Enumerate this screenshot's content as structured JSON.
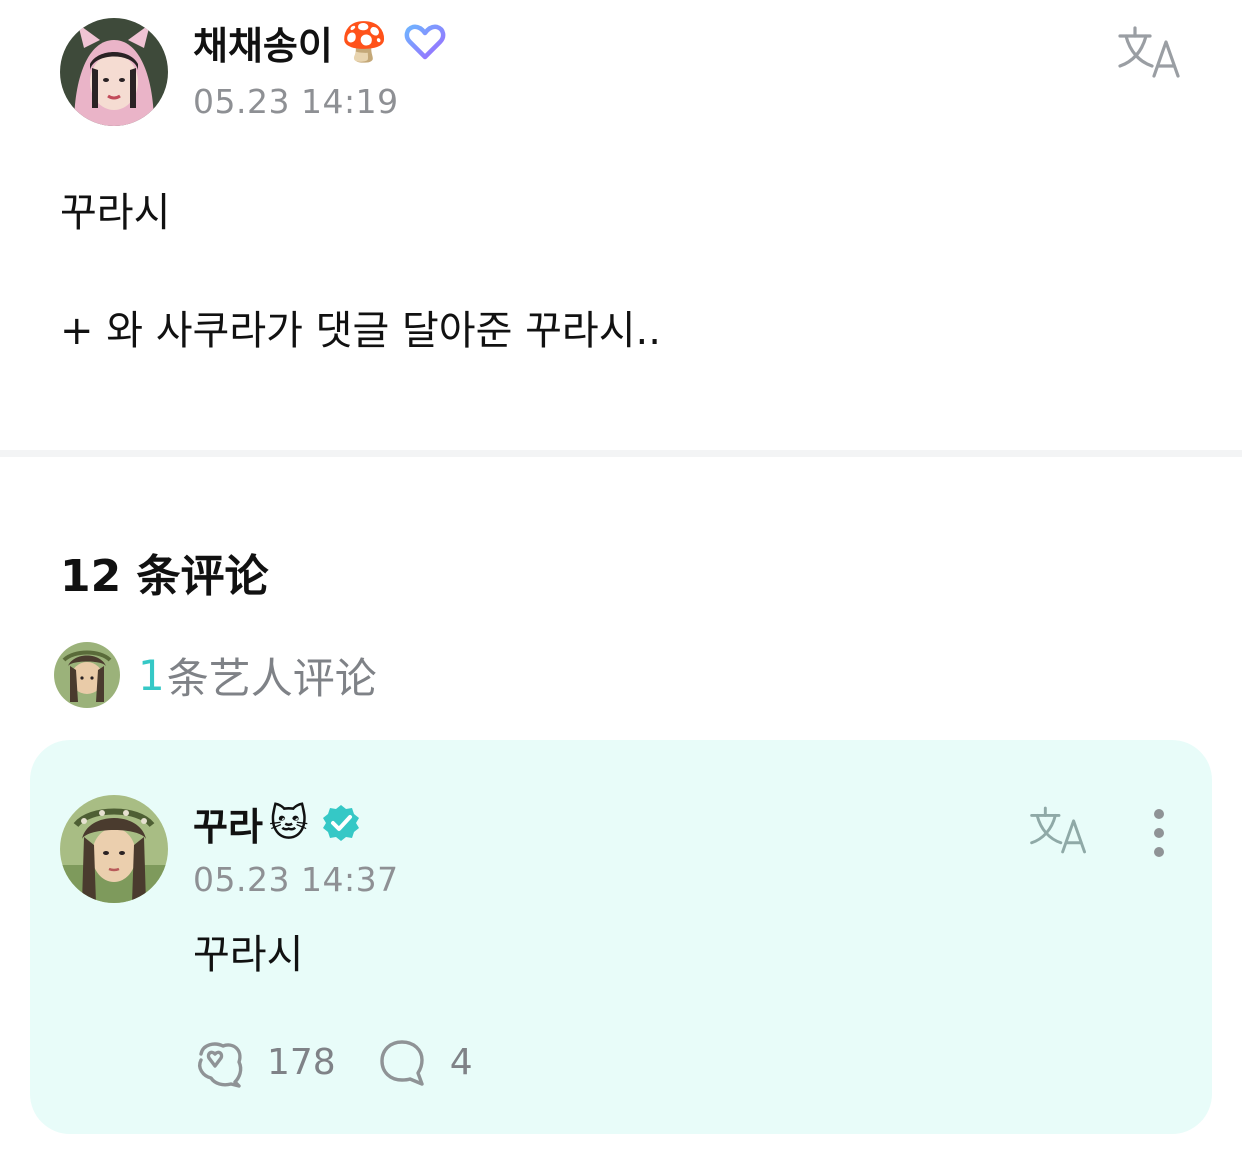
{
  "post": {
    "author": "채채송이",
    "author_emoji": "🍄",
    "timestamp": "05.23 14:19",
    "body_lines": [
      "꾸라시",
      "+ 와 사쿠라가 댓글 달아준 꾸라시.."
    ]
  },
  "comments": {
    "count_label": "12 条评论",
    "artist_count": "1",
    "artist_label": "条艺人评论"
  },
  "comment": {
    "author": "꾸라",
    "author_emoji": "🐱",
    "timestamp": "05.23 14:37",
    "text": "꾸라시",
    "likes": "178",
    "replies": "4"
  },
  "icons": {
    "translate": "translate-icon",
    "fan-heart": "fan-heart-icon",
    "verified": "verified-badge-icon",
    "more": "more-vertical-icon",
    "like": "heart-bubble-icon",
    "reply": "comment-bubble-icon"
  },
  "colors": {
    "accent": "#35c8c6",
    "card_bg": "#e8fcf9",
    "muted": "#8e9094"
  }
}
